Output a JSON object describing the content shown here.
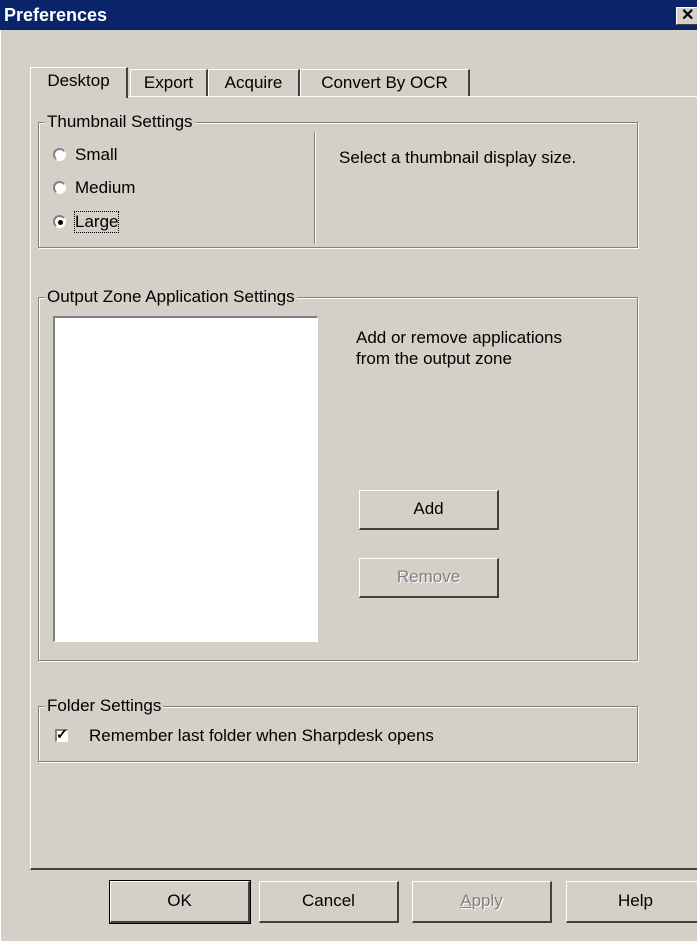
{
  "window": {
    "title": "Preferences",
    "close_glyph": "✕"
  },
  "tabs": [
    {
      "label": "Desktop",
      "active": true
    },
    {
      "label": "Export",
      "active": false
    },
    {
      "label": "Acquire",
      "active": false
    },
    {
      "label": "Convert By OCR",
      "active": false
    }
  ],
  "thumbnail": {
    "legend": "Thumbnail Settings",
    "options": [
      {
        "label": "Small",
        "selected": false
      },
      {
        "label": "Medium",
        "selected": false
      },
      {
        "label": "Large",
        "selected": true
      }
    ],
    "description": "Select a thumbnail display size."
  },
  "output_zone": {
    "legend": "Output Zone Application Settings",
    "description_line1": "Add or remove applications",
    "description_line2": "from the output zone",
    "add_label": "Add",
    "remove_label": "Remove",
    "remove_enabled": false
  },
  "folder": {
    "legend": "Folder Settings",
    "remember_label": "Remember last folder when Sharpdesk opens",
    "remember_checked": true,
    "check_glyph": "✓"
  },
  "footer": {
    "ok_label": "OK",
    "cancel_label": "Cancel",
    "apply_label": "Apply",
    "apply_enabled": false,
    "help_label": "Help"
  }
}
